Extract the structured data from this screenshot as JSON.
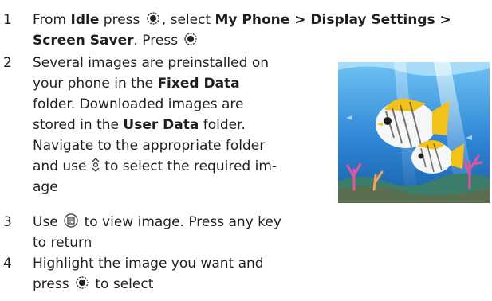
{
  "steps": [
    {
      "number": "1",
      "line1_pre": "From ",
      "line1_bold1": "Idle",
      "line1_mid1": " press ",
      "line1_mid2": ", select ",
      "line1_bold2": "My Phone > Display Settings >",
      "line2_bold": "Screen Saver",
      "line2_post": ". Press ",
      "icons": [
        "select-key-icon",
        "select-key-icon"
      ]
    },
    {
      "number": "2",
      "line1": "Several images are preinstalled on",
      "line2_pre": "your phone in the ",
      "line2_bold": "Fixed Data",
      "line3": "folder. Downloaded images are",
      "line4_pre": "stored in the ",
      "line4_bold": "User Data",
      "line4_post": " folder.",
      "line5": "Navigate to the appropriate folder",
      "line6_pre": "and use ",
      "line6_post": " to select the required im-",
      "line7": "age",
      "icons": [
        "nav-up-down-icon"
      ]
    },
    {
      "number": "3",
      "line1_pre": "Use ",
      "line1_post": " to view image. Press any key",
      "line2": "to return",
      "icons": [
        "view-key-icon"
      ]
    },
    {
      "number": "4",
      "line1": "Highlight the image you want and",
      "line2_pre": "press ",
      "line2_post": " to select",
      "icons": [
        "select-key-icon"
      ]
    }
  ],
  "image": {
    "subject": "screensaver-fish-picture",
    "colors": {
      "water": "#2e86d6",
      "fish": "#f2c218"
    }
  }
}
